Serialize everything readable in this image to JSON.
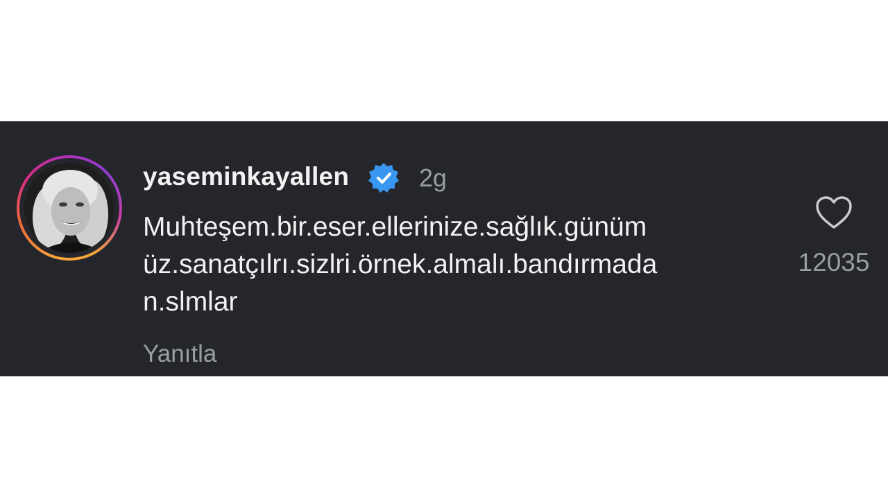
{
  "comment": {
    "username": "yaseminkayallen",
    "verified_icon": "verified-badge-icon",
    "time": "2g",
    "text_lines": [
      "Muhteşem.bir.eser.ellerinize.sağlık.günüm",
      "üz.sanatçılrı.sizlri.örnek.almalı.bandırmada",
      "n.slmlar"
    ],
    "reply_label": "Yanıtla",
    "like_icon": "heart-outline-icon",
    "like_count": "12035"
  },
  "colors": {
    "panel_background": "#24262b",
    "primary_text": "#f2f2f2",
    "secondary_text": "#9a9da3",
    "verified_blue": "#3897f0"
  }
}
